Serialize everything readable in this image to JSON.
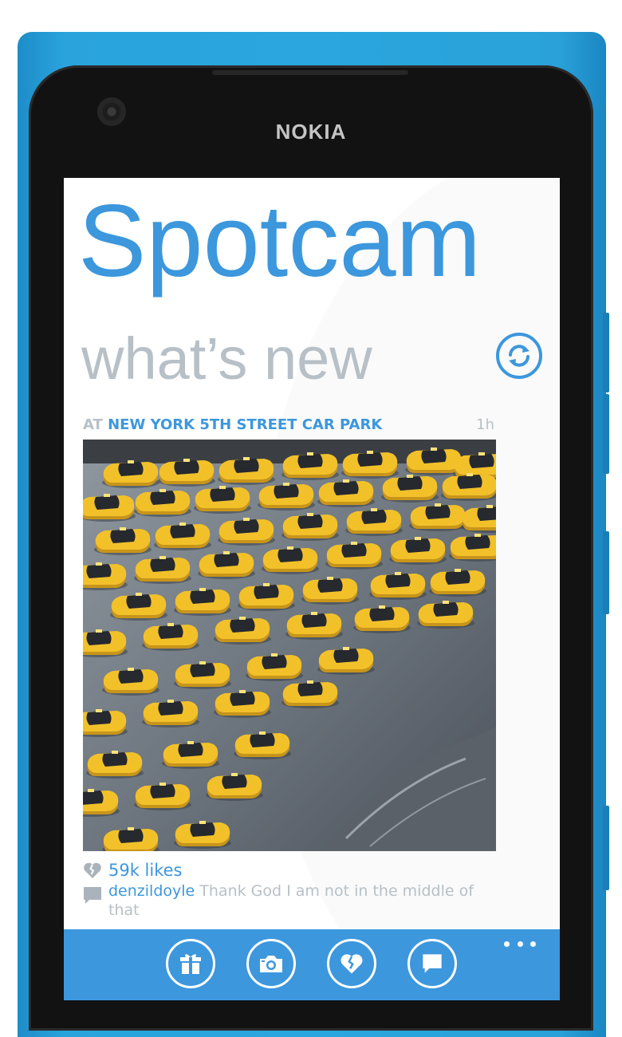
{
  "device": {
    "brand": "NOKIA",
    "body_color": "#2ba6de"
  },
  "app": {
    "title": "Spotcam",
    "section": "what’s new",
    "accent_color": "#3c97dd",
    "muted_color": "#b7c0c7"
  },
  "header": {
    "refresh_icon": "refresh-icon"
  },
  "post": {
    "location_prefix": "AT",
    "location_name": "NEW YORK 5TH STREET CAR PARK",
    "age": "1h",
    "photo_icon": "photo-flooded-taxis",
    "likes_icon": "broken-heart-icon",
    "likes": "59k likes",
    "comment_icon": "comment-icon",
    "comment": {
      "user": "denzildoyle",
      "text": " Thank God I am not in the middle of that"
    }
  },
  "app_bar": {
    "color": "#3c97dd",
    "buttons": [
      {
        "icon": "gift-icon"
      },
      {
        "icon": "camera-icon"
      },
      {
        "icon": "broken-heart-icon"
      },
      {
        "icon": "comment-icon"
      }
    ],
    "more_icon": "ellipsis-icon"
  }
}
